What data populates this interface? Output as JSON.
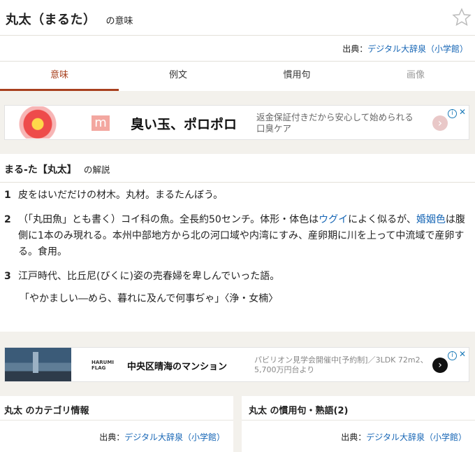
{
  "header": {
    "title": "丸太（まるた）",
    "title_suffix": "の意味",
    "source_prefix": "出典：",
    "source_link": "デジタル大辞泉（小学館）",
    "star_icon": "star-outline-icon"
  },
  "tabs": [
    {
      "label": "意味",
      "state": "active"
    },
    {
      "label": "例文",
      "state": "normal"
    },
    {
      "label": "慣用句",
      "state": "normal"
    },
    {
      "label": "画像",
      "state": "disabled"
    }
  ],
  "ad1": {
    "logo_letter": "m",
    "headline": "臭い玉、ポロポロ",
    "description": "返金保証付きだから安心して始められる口臭ケア",
    "cta": "›"
  },
  "definition": {
    "term": "まる‐た【丸太】",
    "suffix": "の解説",
    "items": [
      {
        "num": "1",
        "text": "皮をはいだだけの材木。丸材。まるたんぼう。"
      },
      {
        "num": "2",
        "part1": "（「丸田魚」とも書く）コイ科の魚。全長約50センチ。体形・体色は",
        "link1": "ウグイ",
        "part2": "によく似るが、",
        "link2": "婚姻色",
        "part3": "は腹側に1本のみ現れる。本州中部地方から北の河口域や内湾にすみ、産卵期に川を上って中流域で産卵する。食用。"
      },
      {
        "num": "3",
        "text": "江戸時代、比丘尼(びくに)姿の売春婦を卑しんでいった語。"
      }
    ],
    "example": "「やかましい―めら、暮れに及んで何事ぢゃ」〈浄・女楠〉"
  },
  "ad2": {
    "brand_line1": "HARUMI",
    "brand_line2": "FLAG",
    "headline": "中央区晴海のマンション",
    "description": "パビリオン見学会開催中[予約制]／3LDK 72m2、5,700万円台より",
    "cta": "›"
  },
  "category_card": {
    "title": "丸太 のカテゴリ情報",
    "source_prefix": "出典：",
    "source_link": "デジタル大辞泉（小学館）"
  },
  "idiom_card": {
    "title": "丸太 の慣用句・熟語(2)",
    "source_prefix": "出典：",
    "source_link": "デジタル大辞泉（小学館）"
  },
  "colors": {
    "accent": "#a8401e",
    "link": "#1565b5",
    "background": "#f3f1ec"
  }
}
